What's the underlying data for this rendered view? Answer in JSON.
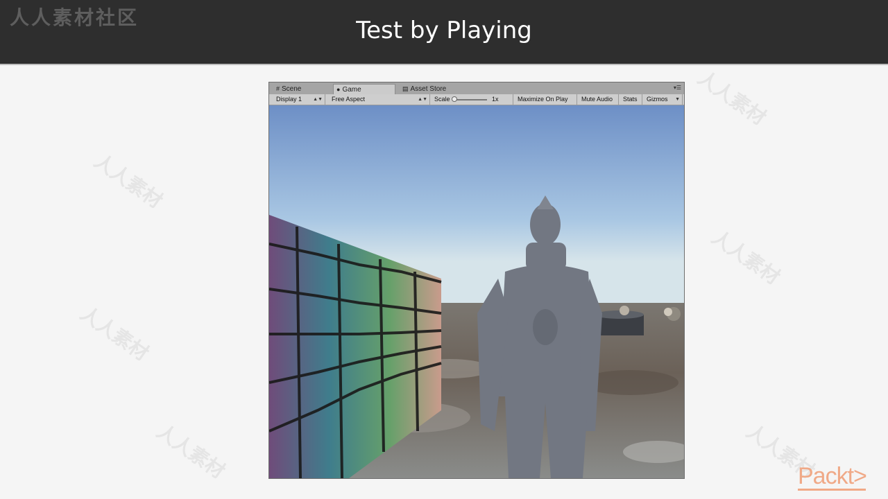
{
  "slide": {
    "title": "Test by Playing",
    "watermark_corner": "人人素材社区",
    "watermark_text": "人人素材",
    "logo": "Packt>"
  },
  "tabs": [
    {
      "label": "Scene",
      "icon": "grid-icon",
      "active": false
    },
    {
      "label": "Game",
      "icon": "game-controller-icon",
      "active": true
    },
    {
      "label": "Asset Store",
      "icon": "shopping-bag-icon",
      "active": false
    }
  ],
  "toolbar": {
    "display": "Display 1",
    "aspect": "Free Aspect",
    "scale_label": "Scale",
    "scale_value": "1x",
    "maximize": "Maximize On Play",
    "mute": "Mute Audio",
    "stats": "Stats",
    "gizmos": "Gizmos"
  },
  "colors": {
    "topbar": "#2e2e2e",
    "sky_top": "#6e90c6",
    "sky_horizon": "#cfe0ea",
    "ground": "#6a625a",
    "character": "#707580",
    "logo": "#f0a987"
  }
}
